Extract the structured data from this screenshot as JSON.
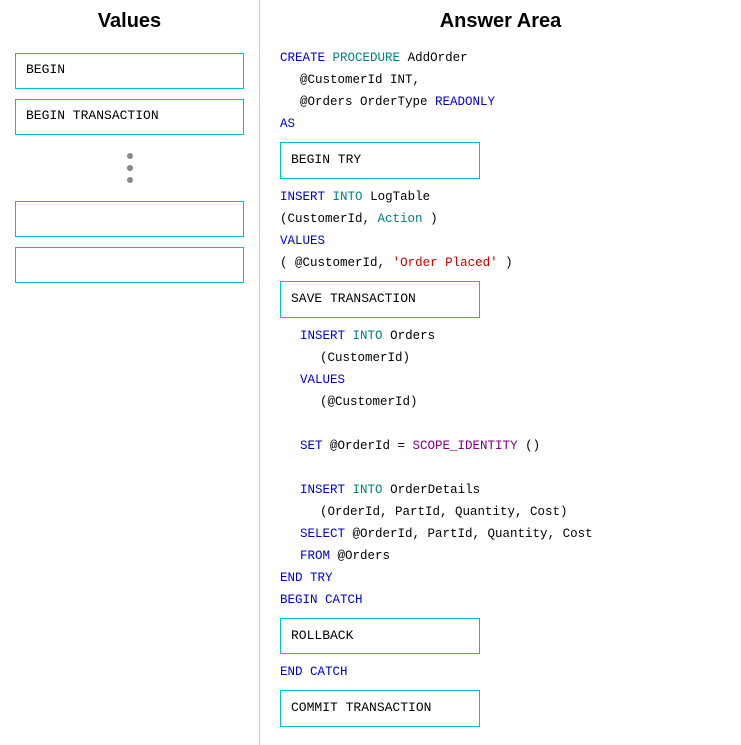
{
  "left": {
    "title": "Values",
    "items": [
      {
        "label": "BEGIN",
        "empty": false
      },
      {
        "label": "BEGIN TRANSACTION",
        "empty": false
      },
      {
        "label": "",
        "empty": true
      },
      {
        "label": "",
        "empty": true
      }
    ],
    "dots": 3
  },
  "right": {
    "title": "Answer Area",
    "code": {
      "line1_kw1": "CREATE",
      "line1_kw2": "PROCEDURE",
      "line1_rest": " AddOrder",
      "line2": "    @CustomerId INT,",
      "line3_kw": "READONLY",
      "line3_rest": "    @Orders OrderType ",
      "line4": "AS",
      "box1": "BEGIN TRY",
      "line5_kw1": "INSERT",
      "line5_kw2": "INTO",
      "line5_rest": " LogTable",
      "line6": "(CustomerId, ",
      "line6_kw": "Action",
      "line6_rest": ")",
      "line7_kw": "VALUES",
      "line8_kw": "@CustomerId",
      "line8_str": "'Order Placed'",
      "line8_rest": "(",
      "line8_end": ")",
      "box2": "SAVE TRANSACTION",
      "line9_kw1": "INSERT",
      "line9_kw2": "INTO",
      "line9_rest": " Orders",
      "line10": "    (CustomerId)",
      "line11_kw": "VALUES",
      "line12": "    (@CustomerId)",
      "line13_kw1": "SET",
      "line13_rest": " @OrderId = ",
      "line13_fn": "SCOPE_IDENTITY",
      "line13_end": "()",
      "line14_kw1": "INSERT",
      "line14_kw2": "INTO",
      "line14_rest": " OrderDetails",
      "line15": "    (OrderId, PartId, Quantity, Cost)",
      "line16_kw": "SELECT",
      "line16_rest": " @OrderId, PartId, Quantity, Cost",
      "line17_kw": "FROM",
      "line17_rest": " @Orders",
      "line18_kw1": "END",
      "line18_kw2": "TRY",
      "line19_kw1": "BEGIN",
      "line19_kw2": "CATCH",
      "box3": "ROLLBACK",
      "line20_kw1": "END",
      "line20_kw2": "CATCH",
      "box4": "COMMIT TRANSACTION"
    }
  }
}
